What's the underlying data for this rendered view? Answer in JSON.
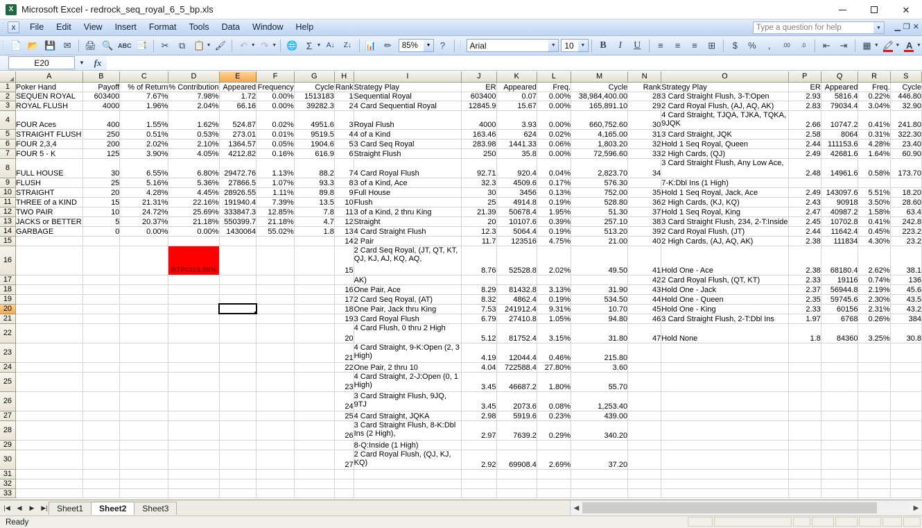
{
  "window": {
    "title": "Microsoft Excel - redrock_seq_royal_6_5_bp.xls",
    "app_icon": "excel-icon",
    "minimize": "–",
    "maximize": "□",
    "close": "✕"
  },
  "menubar": {
    "items": [
      "File",
      "Edit",
      "View",
      "Insert",
      "Format",
      "Tools",
      "Data",
      "Window",
      "Help"
    ],
    "help_placeholder": "Type a question for help"
  },
  "toolbar": {
    "zoom": "85%",
    "font_name": "Arial",
    "font_size": "10",
    "bold": "B",
    "italic": "I",
    "underline": "U",
    "icons": [
      "new-icon",
      "open-icon",
      "save-icon",
      "email-icon",
      "print-icon",
      "print-preview-icon",
      "spellcheck-icon",
      "research-icon",
      "cut-icon",
      "copy-icon",
      "paste-icon",
      "format-painter-icon",
      "undo-icon",
      "redo-icon",
      "hyperlink-icon",
      "autosum-icon",
      "sort-asc-icon",
      "sort-desc-icon",
      "chart-wizard-icon",
      "drawing-icon",
      "help-icon"
    ],
    "format_icons": [
      "align-left-icon",
      "align-center-icon",
      "align-right-icon",
      "merge-center-icon",
      "currency-icon",
      "percent-icon",
      "comma-icon",
      "increase-decimal-icon",
      "decrease-decimal-icon",
      "decrease-indent-icon",
      "increase-indent-icon",
      "borders-icon",
      "fill-color-icon",
      "font-color-icon"
    ]
  },
  "formula_bar": {
    "name_box": "E20",
    "formula": ""
  },
  "grid": {
    "columns": [
      "A",
      "B",
      "C",
      "D",
      "E",
      "F",
      "G",
      "H",
      "I",
      "J",
      "K",
      "L",
      "M",
      "N",
      "O",
      "P",
      "Q",
      "R",
      "S"
    ],
    "selected_column": "E",
    "selected_row": "20",
    "active_cell": "E20",
    "headers": {
      "A": "Poker Hand",
      "B": "Payoff",
      "C": "% of Return",
      "D": "% Contribution",
      "E": "Appeared",
      "F": "Frequency",
      "G": "Cycle",
      "H": "Rank",
      "I": "Strategy Play",
      "J": "ER",
      "K": "Appeared",
      "L": "Freq.",
      "M": "Cycle",
      "N": "Rank",
      "O": "Strategy Play",
      "P": "ER",
      "Q": "Appeared",
      "R": "Freq.",
      "S": "Cycle"
    },
    "rtp_note": "RTP=103.96%",
    "rows": [
      {
        "n": "1",
        "h": 14,
        "A": "Poker Hand",
        "B": "Payoff",
        "C": "% of Return",
        "D": "% Contribution",
        "E": "Appeared",
        "F": "Frequency",
        "G": "Cycle",
        "H": "Rank",
        "I": "Strategy Play",
        "J": "ER",
        "K": "Appeared",
        "L": "Freq.",
        "M": "Cycle",
        "N": "Rank",
        "O": "Strategy Play",
        "P": "ER",
        "Q": "Appeared",
        "R": "Freq.",
        "S": "Cycle",
        "header": true
      },
      {
        "n": "2",
        "h": 13,
        "A": "SEQUEN ROYAL",
        "B": "603400",
        "C": "7.67%",
        "D": "7.98%",
        "E": "1.72",
        "F": "0.00%",
        "G": "1513183",
        "H": "1",
        "I": "Sequential Royal",
        "J": "603400",
        "K": "0.07",
        "L": "0.00%",
        "M": "38,984,400.00",
        "N": "28",
        "O": "3 Card Straight Flush, 3-T:Open",
        "P": "2.93",
        "Q": "5816.4",
        "R": "0.22%",
        "S": "446.80"
      },
      {
        "n": "3",
        "h": 14,
        "A": "ROYAL FLUSH",
        "B": "4000",
        "C": "1.96%",
        "D": "2.04%",
        "E": "66.16",
        "F": "0.00%",
        "G": "39282.3",
        "H": "2",
        "I": "4 Card Sequential Royal",
        "J": "12845.9",
        "K": "15.67",
        "L": "0.00%",
        "M": "165,891.10",
        "N": "29",
        "O": "2 Card Royal Flush, (AJ, AQ, AK)",
        "P": "2.83",
        "Q": "79034.4",
        "R": "3.04%",
        "S": "32.90"
      },
      {
        "n": "4",
        "h": 27,
        "A": "FOUR Aces",
        "B": "400",
        "C": "1.55%",
        "D": "1.62%",
        "E": "524.87",
        "F": "0.02%",
        "G": "4951.6",
        "H": "3",
        "I": "Royal Flush",
        "J": "4000",
        "K": "3.93",
        "L": "0.00%",
        "M": "660,752.60",
        "N": "30",
        "O": "4 Card Straight, TJQA, TJKA, TQKA, 9JQK",
        "P": "2.66",
        "Q": "10747.2",
        "R": "0.41%",
        "S": "241.80",
        "wrapO": true
      },
      {
        "n": "5",
        "h": 14,
        "A": "STRAIGHT FLUSH",
        "B": "250",
        "C": "0.51%",
        "D": "0.53%",
        "E": "273.01",
        "F": "0.01%",
        "G": "9519.5",
        "H": "4",
        "I": "4 of a Kind",
        "J": "163.46",
        "K": "624",
        "L": "0.02%",
        "M": "4,165.00",
        "N": "31",
        "O": "3 Card Straight, JQK",
        "P": "2.58",
        "Q": "8064",
        "R": "0.31%",
        "S": "322.30"
      },
      {
        "n": "6",
        "h": 14,
        "A": "FOUR 2,3,4",
        "B": "200",
        "C": "2.02%",
        "D": "2.10%",
        "E": "1364.57",
        "F": "0.05%",
        "G": "1904.6",
        "H": "5",
        "I": "3 Card Seq Royal",
        "J": "283.98",
        "K": "1441.33",
        "L": "0.06%",
        "M": "1,803.20",
        "N": "32",
        "O": "Hold 1 Seq Royal, Queen",
        "P": "2.44",
        "Q": "111153.6",
        "R": "4.28%",
        "S": "23.40"
      },
      {
        "n": "7",
        "h": 14,
        "A": "FOUR 5 - K",
        "B": "125",
        "C": "3.90%",
        "D": "4.05%",
        "E": "4212.82",
        "F": "0.16%",
        "G": "616.9",
        "H": "6",
        "I": "Straight Flush",
        "J": "250",
        "K": "35.8",
        "L": "0.00%",
        "M": "72,596.60",
        "N": "33",
        "O": "2 High Cards, (QJ)",
        "P": "2.49",
        "Q": "42681.6",
        "R": "1.64%",
        "S": "60.90"
      },
      {
        "n": "8",
        "h": 28,
        "A": "FULL HOUSE",
        "B": "30",
        "C": "6.55%",
        "D": "6.80%",
        "E": "29472.76",
        "F": "1.13%",
        "G": "88.2",
        "H": "7",
        "I": "4 Card Royal Flush",
        "J": "92.71",
        "K": "920.4",
        "L": "0.04%",
        "M": "2,823.70",
        "N": "34",
        "O": "3 Card Straight Flush, Any Low Ace,",
        "P": "2.48",
        "Q": "14961.6",
        "R": "0.58%",
        "S": "173.70",
        "wrapO": true
      },
      {
        "n": "9",
        "h": 14,
        "A": "FLUSH",
        "B": "25",
        "C": "5.16%",
        "D": "5.36%",
        "E": "27866.5",
        "F": "1.07%",
        "G": "93.3",
        "H": "8",
        "I": "3 of a Kind, Ace",
        "J": "32.3",
        "K": "4509.6",
        "L": "0.17%",
        "M": "576.30",
        "N": "",
        "O": "7-K:Dbl Ins (1 High)",
        "P": "",
        "Q": "",
        "R": "",
        "S": ""
      },
      {
        "n": "10",
        "h": 14,
        "A": "STRAIGHT",
        "B": "20",
        "C": "4.28%",
        "D": "4.45%",
        "E": "28926.55",
        "F": "1.11%",
        "G": "89.8",
        "H": "9",
        "I": "Full House",
        "J": "30",
        "K": "3456",
        "L": "0.13%",
        "M": "752.00",
        "N": "35",
        "O": "Hold 1 Seq Royal, Jack, Ace",
        "P": "2.49",
        "Q": "143097.6",
        "R": "5.51%",
        "S": "18.20"
      },
      {
        "n": "11",
        "h": 14,
        "A": "THREE of a KIND",
        "B": "15",
        "C": "21.31%",
        "D": "22.16%",
        "E": "191940.4",
        "F": "7.39%",
        "G": "13.5",
        "H": "10",
        "I": "Flush",
        "J": "25",
        "K": "4914.8",
        "L": "0.19%",
        "M": "528.80",
        "N": "36",
        "O": "2 High Cards, (KJ, KQ)",
        "P": "2.43",
        "Q": "90918",
        "R": "3.50%",
        "S": "28.60"
      },
      {
        "n": "12",
        "h": 14,
        "A": "TWO PAIR",
        "B": "10",
        "C": "24.72%",
        "D": "25.69%",
        "E": "333847.3",
        "F": "12.85%",
        "G": "7.8",
        "H": "11",
        "I": "3 of a Kind, 2 thru King",
        "J": "21.39",
        "K": "50678.4",
        "L": "1.95%",
        "M": "51.30",
        "N": "37",
        "O": "Hold 1 Seq Royal, King",
        "P": "2.47",
        "Q": "40987.2",
        "R": "1.58%",
        "S": "63.4"
      },
      {
        "n": "13",
        "h": 14,
        "A": "JACKS or BETTER",
        "B": "5",
        "C": "20.37%",
        "D": "21.18%",
        "E": "550399.7",
        "F": "21.18%",
        "G": "4.7",
        "H": "12",
        "I": "Straight",
        "J": "20",
        "K": "10107.6",
        "L": "0.39%",
        "M": "257.10",
        "N": "38",
        "O": "3 Card Straight Flush, 234, 2-T:Inside",
        "P": "2.45",
        "Q": "10702.8",
        "R": "0.41%",
        "S": "242.8"
      },
      {
        "n": "14",
        "h": 14,
        "A": "GARBAGE",
        "B": "0",
        "C": "0.00%",
        "D": "0.00%",
        "E": "1430064",
        "F": "55.02%",
        "G": "1.8",
        "H": "13",
        "I": "4 Card Straight Flush",
        "J": "12.3",
        "K": "5064.4",
        "L": "0.19%",
        "M": "513.20",
        "N": "39",
        "O": "2 Card Royal Flush, (JT)",
        "P": "2.44",
        "Q": "11642.4",
        "R": "0.45%",
        "S": "223.2"
      },
      {
        "n": "15",
        "h": 14,
        "A": "",
        "B": "",
        "C": "",
        "D": "",
        "E": "",
        "F": "",
        "G": "",
        "H": "14",
        "I": "2 Pair",
        "J": "11.7",
        "K": "123516",
        "L": "4.75%",
        "M": "21.00",
        "N": "40",
        "O": "2 High Cards, (AJ, AQ, AK)",
        "P": "2.38",
        "Q": "111834",
        "R": "4.30%",
        "S": "23.2"
      },
      {
        "n": "16",
        "h": 42,
        "A": "",
        "B": "",
        "C": "",
        "D": "RTP=103.96%",
        "E": "",
        "F": "",
        "G": "",
        "H": "15",
        "I": "2 Card Seq Royal, (JT, QT, KT, QJ, KJ, AJ, KQ, AQ,",
        "J": "8.76",
        "K": "52528.8",
        "L": "2.02%",
        "M": "49.50",
        "N": "41",
        "O": "Hold One - Ace",
        "P": "2.38",
        "Q": "68180.4",
        "R": "2.62%",
        "S": "38.1",
        "rtp": true,
        "wrapI": true
      },
      {
        "n": "17",
        "h": 14,
        "A": "",
        "B": "",
        "C": "",
        "D": "",
        "E": "",
        "F": "",
        "G": "",
        "H": "",
        "I": "AK)",
        "J": "",
        "K": "",
        "L": "",
        "M": "",
        "N": "42",
        "O": "2 Card Royal Flush, (QT, KT)",
        "P": "2.33",
        "Q": "19116",
        "R": "0.74%",
        "S": "136"
      },
      {
        "n": "18",
        "h": 14,
        "A": "",
        "B": "",
        "C": "",
        "D": "",
        "E": "",
        "F": "",
        "G": "",
        "H": "16",
        "I": "One Pair, Ace",
        "J": "8.29",
        "K": "81432.8",
        "L": "3.13%",
        "M": "31.90",
        "N": "43",
        "O": "Hold One - Jack",
        "P": "2.37",
        "Q": "56944.8",
        "R": "2.19%",
        "S": "45.6"
      },
      {
        "n": "19",
        "h": 14,
        "A": "",
        "B": "",
        "C": "",
        "D": "",
        "E": "",
        "F": "",
        "G": "",
        "H": "17",
        "I": "2 Card Seq Royal, (AT)",
        "J": "8.32",
        "K": "4862.4",
        "L": "0.19%",
        "M": "534.50",
        "N": "44",
        "O": "Hold One - Queen",
        "P": "2.35",
        "Q": "59745.6",
        "R": "2.30%",
        "S": "43.5"
      },
      {
        "n": "20",
        "h": 14,
        "A": "",
        "B": "",
        "C": "",
        "D": "",
        "E": "",
        "F": "",
        "G": "",
        "H": "18",
        "I": "One Pair, Jack thru King",
        "J": "7.53",
        "K": "241912.4",
        "L": "9.31%",
        "M": "10.70",
        "N": "45",
        "O": "Hold One - King",
        "P": "2.33",
        "Q": "60156",
        "R": "2.31%",
        "S": "43.2",
        "selected": true
      },
      {
        "n": "21",
        "h": 14,
        "A": "",
        "B": "",
        "C": "",
        "D": "",
        "E": "",
        "F": "",
        "G": "",
        "H": "19",
        "I": "3 Card Royal Flush",
        "J": "6.79",
        "K": "27410.8",
        "L": "1.05%",
        "M": "94.80",
        "N": "46",
        "O": "3 Card Straight Flush, 2-T:Dbl Ins",
        "P": "1.97",
        "Q": "6768",
        "R": "0.26%",
        "S": "384"
      },
      {
        "n": "22",
        "h": 28,
        "A": "",
        "B": "",
        "C": "",
        "D": "",
        "E": "",
        "F": "",
        "G": "",
        "H": "20",
        "I": "4 Card Flush, 0 thru 2 High",
        "J": "5.12",
        "K": "81752.4",
        "L": "3.15%",
        "M": "31.80",
        "N": "47",
        "O": "Hold None",
        "P": "1.8",
        "Q": "84360",
        "R": "3.25%",
        "S": "30.8",
        "wrapI": true
      },
      {
        "n": "23",
        "h": 28,
        "A": "",
        "B": "",
        "C": "",
        "D": "",
        "E": "",
        "F": "",
        "G": "",
        "H": "21",
        "I": "4 Card Straight, 9-K:Open (2, 3 High)",
        "J": "4.19",
        "K": "12044.4",
        "L": "0.46%",
        "M": "215.80",
        "N": "",
        "O": "",
        "P": "",
        "Q": "",
        "R": "",
        "S": "",
        "wrapI": true
      },
      {
        "n": "24",
        "h": 14,
        "A": "",
        "B": "",
        "C": "",
        "D": "",
        "E": "",
        "F": "",
        "G": "",
        "H": "22",
        "I": "One Pair, 2 thru 10",
        "J": "4.04",
        "K": "722588.4",
        "L": "27.80%",
        "M": "3.60",
        "N": "",
        "O": "",
        "P": "",
        "Q": "",
        "R": "",
        "S": ""
      },
      {
        "n": "25",
        "h": 28,
        "A": "",
        "B": "",
        "C": "",
        "D": "",
        "E": "",
        "F": "",
        "G": "",
        "H": "23",
        "I": "4 Card Straight, 2-J:Open (0, 1 High)",
        "J": "3.45",
        "K": "46687.2",
        "L": "1.80%",
        "M": "55.70",
        "N": "",
        "O": "",
        "P": "",
        "Q": "",
        "R": "",
        "S": "",
        "wrapI": true
      },
      {
        "n": "26",
        "h": 28,
        "A": "",
        "B": "",
        "C": "",
        "D": "",
        "E": "",
        "F": "",
        "G": "",
        "H": "24",
        "I": "3 Card Straight Flush, 9JQ, 9TJ",
        "J": "3.45",
        "K": "2073.6",
        "L": "0.08%",
        "M": "1,253.40",
        "N": "",
        "O": "",
        "P": "",
        "Q": "",
        "R": "",
        "S": "",
        "wrapI": true
      },
      {
        "n": "27",
        "h": 14,
        "A": "",
        "B": "",
        "C": "",
        "D": "",
        "E": "",
        "F": "",
        "G": "",
        "H": "25",
        "I": "4 Card Straight, JQKA",
        "J": "2.98",
        "K": "5919.6",
        "L": "0.23%",
        "M": "439.00",
        "N": "",
        "O": "",
        "P": "",
        "Q": "",
        "R": "",
        "S": ""
      },
      {
        "n": "28",
        "h": 28,
        "A": "",
        "B": "",
        "C": "",
        "D": "",
        "E": "",
        "F": "",
        "G": "",
        "H": "26",
        "I": "3 Card Straight Flush, 8-K:Dbl Ins (2 High),",
        "J": "2.97",
        "K": "7639.2",
        "L": "0.29%",
        "M": "340.20",
        "N": "",
        "O": "",
        "P": "",
        "Q": "",
        "R": "",
        "S": "",
        "wrapI": true
      },
      {
        "n": "29",
        "h": 14,
        "A": "",
        "B": "",
        "C": "",
        "D": "",
        "E": "",
        "F": "",
        "G": "",
        "H": "",
        "I": "8-Q:Inside (1 High)",
        "J": "",
        "K": "",
        "L": "",
        "M": "",
        "N": "",
        "O": "",
        "P": "",
        "Q": "",
        "R": "",
        "S": ""
      },
      {
        "n": "30",
        "h": 28,
        "A": "",
        "B": "",
        "C": "",
        "D": "",
        "E": "",
        "F": "",
        "G": "",
        "H": "27",
        "I": "2 Card Royal Flush, (QJ, KJ, KQ)",
        "J": "2.92",
        "K": "69908.4",
        "L": "2.69%",
        "M": "37.20",
        "N": "",
        "O": "",
        "P": "",
        "Q": "",
        "R": "",
        "S": "",
        "wrapI": true
      },
      {
        "n": "31",
        "h": 14,
        "A": "",
        "B": "",
        "C": "",
        "D": "",
        "E": "",
        "F": "",
        "G": "",
        "H": "",
        "I": "",
        "J": "",
        "K": "",
        "L": "",
        "M": "",
        "N": "",
        "O": "",
        "P": "",
        "Q": "",
        "R": "",
        "S": ""
      },
      {
        "n": "32",
        "h": 14,
        "A": "",
        "B": "",
        "C": "",
        "D": "",
        "E": "",
        "F": "",
        "G": "",
        "H": "",
        "I": "",
        "J": "",
        "K": "",
        "L": "",
        "M": "",
        "N": "",
        "O": "",
        "P": "",
        "Q": "",
        "R": "",
        "S": ""
      },
      {
        "n": "33",
        "h": 10,
        "A": "",
        "B": "",
        "C": "",
        "D": "",
        "E": "",
        "F": "",
        "G": "",
        "H": "",
        "I": "",
        "J": "",
        "K": "",
        "L": "",
        "M": "",
        "N": "",
        "O": "",
        "P": "",
        "Q": "",
        "R": "",
        "S": ""
      }
    ]
  },
  "sheet_tabs": {
    "tabs": [
      "Sheet1",
      "Sheet2",
      "Sheet3"
    ],
    "active": "Sheet2",
    "nav": [
      "first-sheet-icon",
      "prev-sheet-icon",
      "next-sheet-icon",
      "last-sheet-icon"
    ]
  },
  "status_bar": {
    "text": "Ready"
  },
  "colors": {
    "rtp_fill": "#ff0000",
    "rtp_text": "#8b0000",
    "selection_header": "#f5a94e",
    "grid_line": "#d4d4d4"
  }
}
